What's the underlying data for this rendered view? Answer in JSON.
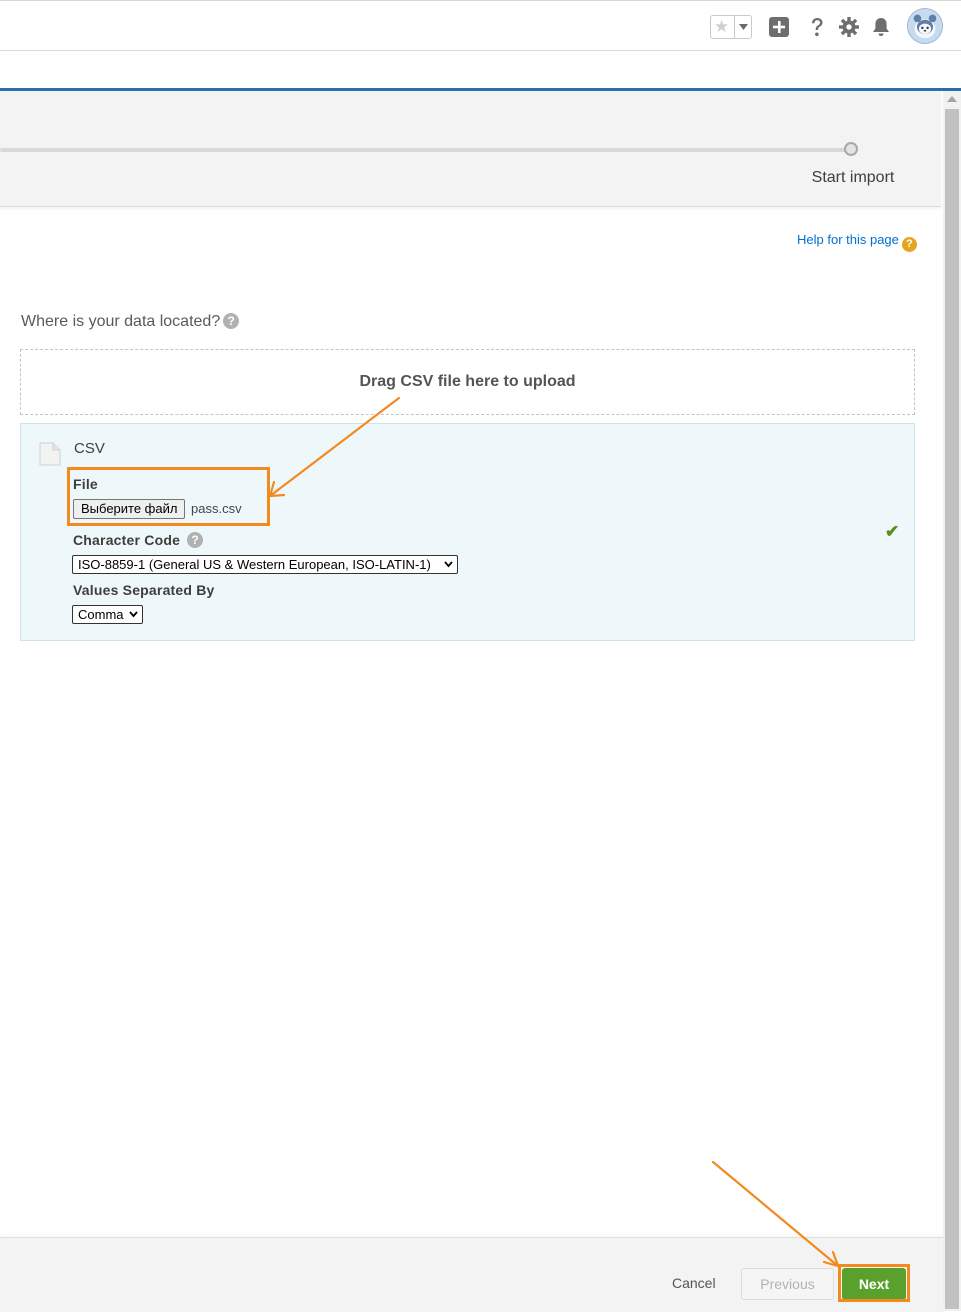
{
  "header": {
    "favorites_icon": "star-icon",
    "add_icon": "plus-square-icon",
    "help_icon": "question-icon",
    "settings_icon": "gear-icon",
    "notifications_icon": "bell-icon",
    "avatar_icon": "astro-avatar-icon"
  },
  "wizard": {
    "step_label": "Start import"
  },
  "help": {
    "link_text": "Help for this page",
    "icon_glyph": "?"
  },
  "source": {
    "question": "Where is your data located?",
    "info_glyph": "?",
    "dropzone_text": "Drag CSV file here to upload"
  },
  "csv": {
    "title": "CSV",
    "file_label": "File",
    "file_button": "Выберите файл",
    "file_name": "pass.csv",
    "char_code_label": "Character Code",
    "char_code_value": "ISO-8859-1 (General US & Western European, ISO-LATIN-1)",
    "separator_label": "Values Separated By",
    "separator_value": "Comma",
    "status_glyph": "✔"
  },
  "footer": {
    "cancel": "Cancel",
    "previous": "Previous",
    "next": "Next"
  },
  "colors": {
    "accent_blue": "#2e6ea6",
    "next_green": "#5aa02c",
    "annotation_orange": "#f28a1e",
    "panel_bg": "#eef8fb"
  }
}
